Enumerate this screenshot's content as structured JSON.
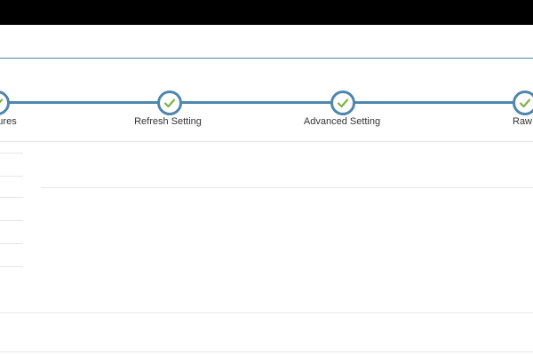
{
  "wizard": {
    "steps": [
      {
        "label": "ures",
        "status": "complete"
      },
      {
        "label": "Refresh Setting",
        "status": "complete"
      },
      {
        "label": "Advanced Setting",
        "status": "complete"
      },
      {
        "label": "Raw Table",
        "status": "complete"
      }
    ]
  },
  "colors": {
    "track": "#4e86ad",
    "check": "#7cb342",
    "topbar": "#000000"
  }
}
